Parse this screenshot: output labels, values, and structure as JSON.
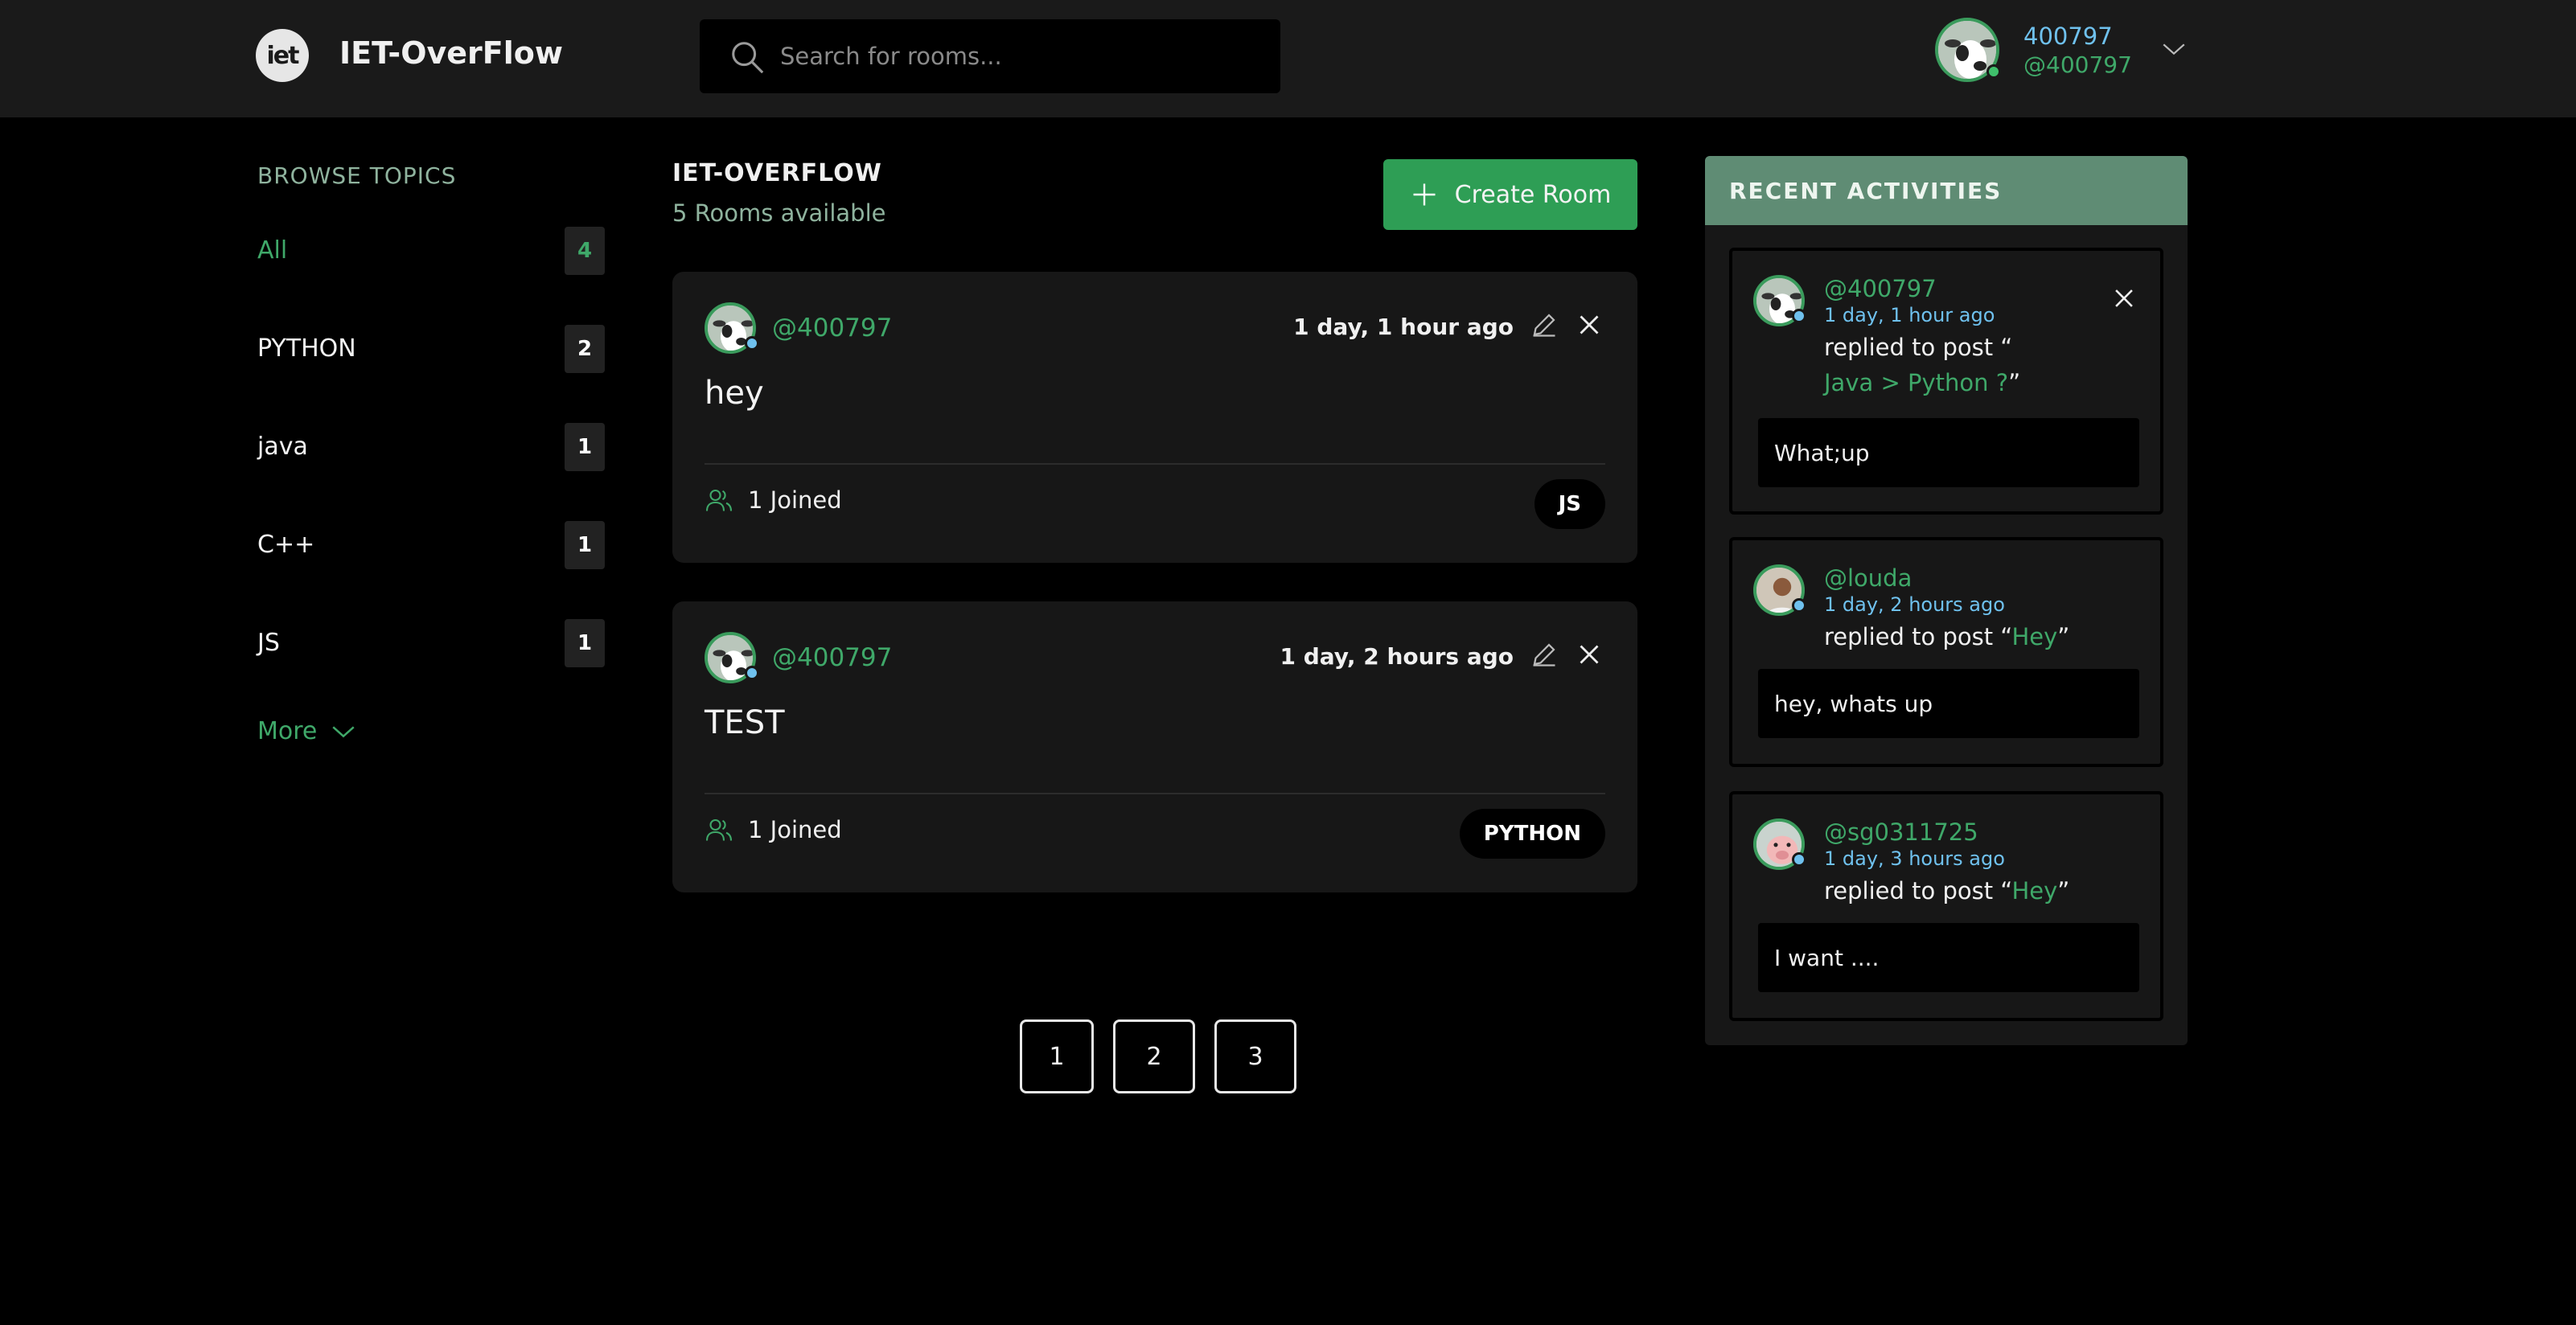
{
  "header": {
    "logo_text": "iet",
    "brand": "IET-OverFlow",
    "search_placeholder": "Search for rooms...",
    "user_name": "400797",
    "user_handle": "@400797"
  },
  "sidebar": {
    "title": "BROWSE TOPICS",
    "topics": [
      {
        "name": "All",
        "count": "4"
      },
      {
        "name": "PYTHON",
        "count": "2"
      },
      {
        "name": "java",
        "count": "1"
      },
      {
        "name": "C++",
        "count": "1"
      },
      {
        "name": "JS",
        "count": "1"
      }
    ],
    "more_label": "More"
  },
  "feed": {
    "title": "IET-OVERFLOW",
    "subtitle": "5 Rooms available",
    "create_label": "Create Room",
    "rooms": [
      {
        "handle": "@400797",
        "time": "1 day, 1 hour ago",
        "title": "hey",
        "joined": "1 Joined",
        "tag": "JS"
      },
      {
        "handle": "@400797",
        "time": "1 day, 2 hours ago",
        "title": "TEST",
        "joined": "1 Joined",
        "tag": "PYTHON"
      }
    ],
    "pages": [
      "1",
      "2",
      "3"
    ]
  },
  "activity": {
    "title": "RECENT ACTIVITIES",
    "items": [
      {
        "handle": "@400797",
        "time": "1 day, 1 hour ago",
        "prefix": "replied to post “",
        "post": "Java > Python ?",
        "suffix": "”",
        "message": "What;up"
      },
      {
        "handle": "@louda",
        "time": "1 day, 2 hours ago",
        "prefix": "replied to post “",
        "post": "Hey",
        "suffix": "”",
        "message": "hey, whats up"
      },
      {
        "handle": "@sg0311725",
        "time": "1 day, 3 hours ago",
        "prefix": "replied to post “",
        "post": "Hey",
        "suffix": "”",
        "message": "I want ...."
      }
    ]
  },
  "colors": {
    "accent_green": "#2e9e55",
    "link_green": "#3fa869",
    "time_blue": "#6fc1ee",
    "activity_header": "#5f8c74"
  }
}
